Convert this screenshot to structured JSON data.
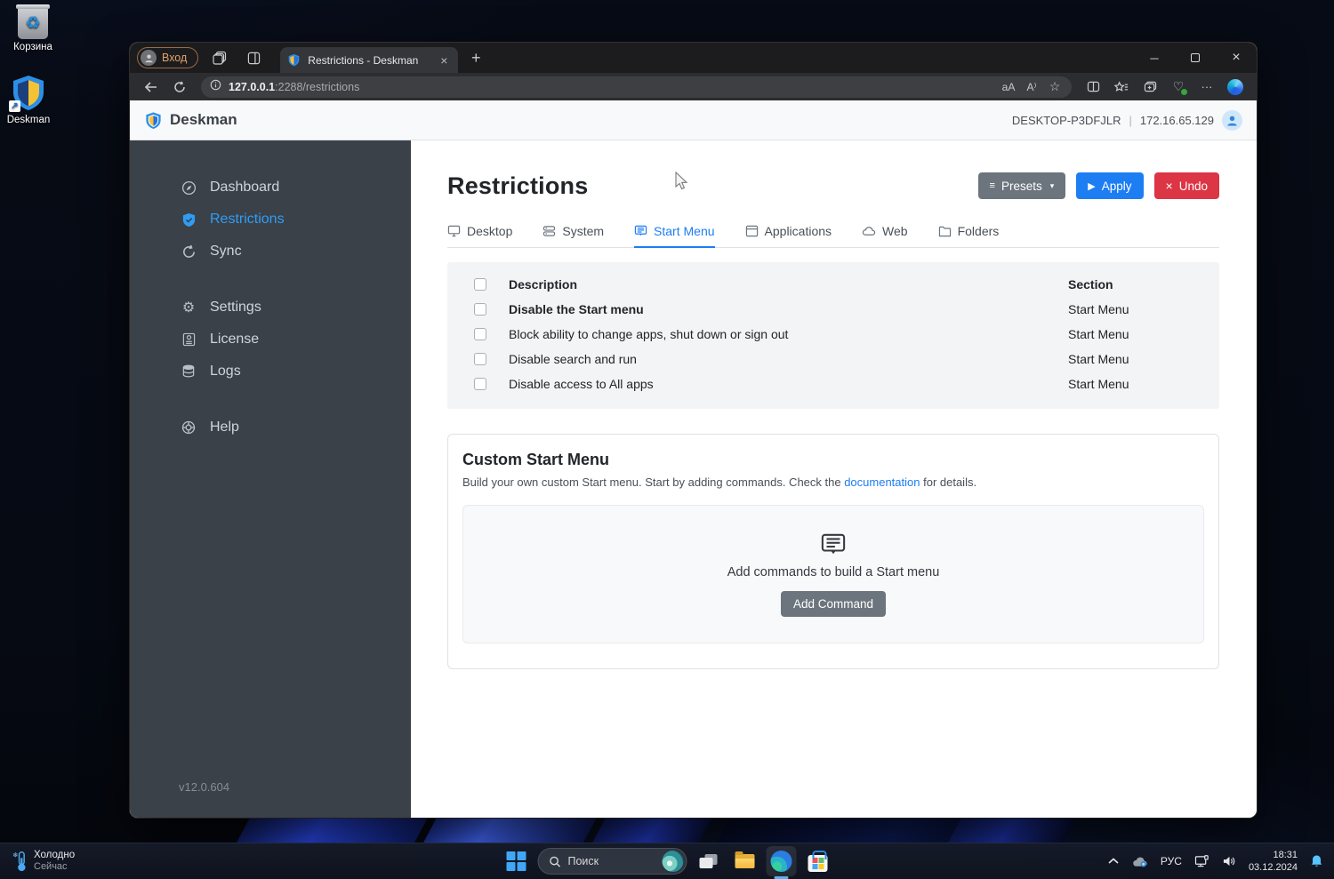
{
  "desktop": {
    "icons": [
      {
        "label": "Корзина"
      },
      {
        "label": "Deskman"
      }
    ]
  },
  "browser": {
    "profile_label": "Вход",
    "tab_title": "Restrictions - Deskman",
    "address_host": "127.0.0.1",
    "address_rest": ":2288/restrictions"
  },
  "app": {
    "brand": "Deskman",
    "device_name": "DESKTOP-P3DFJLR",
    "device_ip": "172.16.65.129",
    "sidebar": {
      "items": [
        {
          "label": "Dashboard",
          "icon": "compass-icon"
        },
        {
          "label": "Restrictions",
          "icon": "shield-check-icon"
        },
        {
          "label": "Sync",
          "icon": "sync-icon"
        },
        {
          "label": "Settings",
          "icon": "gear-icon"
        },
        {
          "label": "License",
          "icon": "license-card-icon"
        },
        {
          "label": "Logs",
          "icon": "database-icon"
        },
        {
          "label": "Help",
          "icon": "life-ring-icon"
        }
      ],
      "version": "v12.0.604"
    },
    "page": {
      "title": "Restrictions",
      "buttons": {
        "presets": "Presets",
        "apply": "Apply",
        "undo": "Undo"
      },
      "tabs": [
        {
          "label": "Desktop",
          "icon": "monitor-icon"
        },
        {
          "label": "System",
          "icon": "server-icon"
        },
        {
          "label": "Start Menu",
          "icon": "start-menu-icon",
          "active": true
        },
        {
          "label": "Applications",
          "icon": "window-icon"
        },
        {
          "label": "Web",
          "icon": "cloud-icon"
        },
        {
          "label": "Folders",
          "icon": "folder-icon"
        }
      ],
      "table": {
        "headers": {
          "description": "Description",
          "section": "Section"
        },
        "rows": [
          {
            "description": "Disable the Start menu",
            "section": "Start Menu"
          },
          {
            "description": "Block ability to change apps, shut down or sign out",
            "section": "Start Menu"
          },
          {
            "description": "Disable search and run",
            "section": "Start Menu"
          },
          {
            "description": "Disable access to All apps",
            "section": "Start Menu"
          }
        ]
      },
      "custom_start_menu": {
        "title": "Custom Start Menu",
        "desc_before": "Build your own custom Start menu. Start by adding commands. Check the ",
        "link": "documentation",
        "desc_after": " for details.",
        "empty_text": "Add commands to build a Start menu",
        "add_button": "Add Command"
      }
    }
  },
  "taskbar": {
    "weather": {
      "line1": "Холодно",
      "line2": "Сейчас"
    },
    "search_label": "Поиск",
    "tray": {
      "lang": "РУС",
      "time": "18:31",
      "date": "03.12.2024"
    }
  },
  "colors": {
    "accent_blue": "#1d7df3",
    "sidebar_active_blue": "#2f9df5",
    "danger_red": "#dc3545",
    "secondary_gray": "#6c757d",
    "brand_yellow": "#f5c235"
  }
}
